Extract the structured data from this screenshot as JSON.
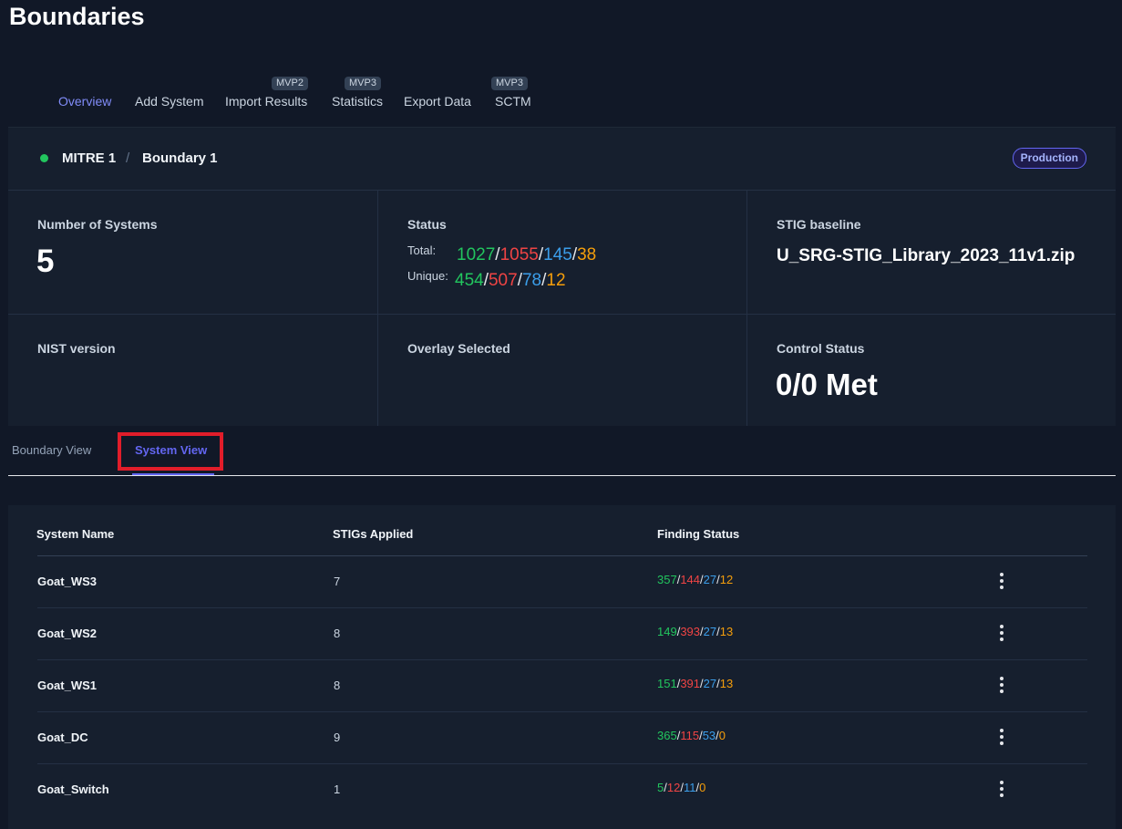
{
  "page": {
    "title": "Boundaries"
  },
  "nav": [
    {
      "label": "Overview",
      "badge": "",
      "active": true
    },
    {
      "label": "Add System",
      "badge": ""
    },
    {
      "label": "Import Results",
      "badge": "MVP2"
    },
    {
      "label": "Statistics",
      "badge": "MVP3"
    },
    {
      "label": "Export Data",
      "badge": ""
    },
    {
      "label": "SCTM",
      "badge": "MVP3"
    }
  ],
  "breadcrumb": {
    "status_color": "#22c55e",
    "org": "MITRE 1",
    "separator": "/",
    "boundary": "Boundary 1",
    "env_badge": "Production"
  },
  "stats": {
    "systems": {
      "label": "Number of Systems",
      "value": "5"
    },
    "status": {
      "label": "Status",
      "total_label": "Total:",
      "total": {
        "pass": "1027",
        "fail": "1055",
        "na": "145",
        "nr": "38"
      },
      "unique_label": "Unique:",
      "unique": {
        "pass": "454",
        "fail": "507",
        "na": "78",
        "nr": "12"
      },
      "sep": "/"
    },
    "stig": {
      "label": "STIG baseline",
      "value": "U_SRG-STIG_Library_2023_11v1.zip"
    },
    "nist": {
      "label": "NIST version",
      "value": ""
    },
    "overlay": {
      "label": "Overlay Selected",
      "value": ""
    },
    "control": {
      "label": "Control Status",
      "value": "0/0 Met"
    }
  },
  "colors": {
    "pass": "#22c55e",
    "fail": "#ef4444",
    "na": "#3b9eea",
    "nr": "#f59e0b",
    "accent": "#6366f1",
    "highlight": "#e11d2a"
  },
  "view_tabs": [
    {
      "label": "Boundary View"
    },
    {
      "label": "System View",
      "active": true
    }
  ],
  "table": {
    "headers": {
      "name": "System Name",
      "stigs": "STIGs Applied",
      "finding": "Finding Status"
    },
    "rows": [
      {
        "name": "Goat_WS3",
        "stigs": "7",
        "pass": "357",
        "fail": "144",
        "na": "27",
        "nr": "12"
      },
      {
        "name": "Goat_WS2",
        "stigs": "8",
        "pass": "149",
        "fail": "393",
        "na": "27",
        "nr": "13"
      },
      {
        "name": "Goat_WS1",
        "stigs": "8",
        "pass": "151",
        "fail": "391",
        "na": "27",
        "nr": "13"
      },
      {
        "name": "Goat_DC",
        "stigs": "9",
        "pass": "365",
        "fail": "115",
        "na": "53",
        "nr": "0"
      },
      {
        "name": "Goat_Switch",
        "stigs": "1",
        "pass": "5",
        "fail": "12",
        "na": "11",
        "nr": "0"
      }
    ],
    "row_menu_icon": "kebab-icon",
    "sep": "/"
  }
}
